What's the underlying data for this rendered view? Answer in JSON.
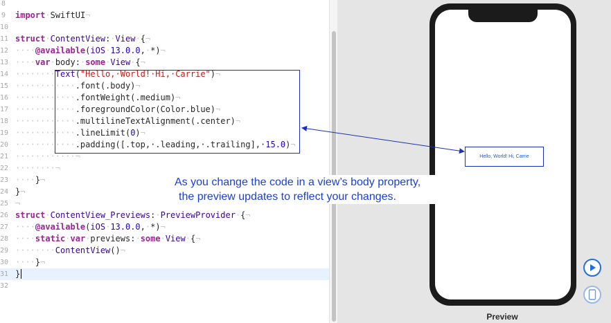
{
  "editor": {
    "lines": [
      {
        "n": "8",
        "tokens": []
      },
      {
        "n": "9",
        "tokens": [
          {
            "t": "import",
            "c": "kw"
          },
          {
            "t": "·",
            "c": "ws"
          },
          {
            "t": "SwiftUI",
            "c": "pl"
          },
          {
            "t": "¬",
            "c": "ws"
          }
        ]
      },
      {
        "n": "10",
        "tokens": []
      },
      {
        "n": "11",
        "tokens": [
          {
            "t": "struct",
            "c": "kw"
          },
          {
            "t": "·",
            "c": "ws"
          },
          {
            "t": "ContentView",
            "c": "tp"
          },
          {
            "t": ":",
            "c": "pl"
          },
          {
            "t": "·",
            "c": "ws"
          },
          {
            "t": "View",
            "c": "tp"
          },
          {
            "t": "·",
            "c": "ws"
          },
          {
            "t": "{",
            "c": "pl"
          },
          {
            "t": "¬",
            "c": "ws"
          }
        ]
      },
      {
        "n": "12",
        "tokens": [
          {
            "t": "····",
            "c": "ws"
          },
          {
            "t": "@available",
            "c": "kw"
          },
          {
            "t": "(",
            "c": "pl"
          },
          {
            "t": "iOS",
            "c": "tp"
          },
          {
            "t": "·",
            "c": "ws"
          },
          {
            "t": "13.0.0",
            "c": "nu"
          },
          {
            "t": ",",
            "c": "pl"
          },
          {
            "t": "·",
            "c": "ws"
          },
          {
            "t": "*)",
            "c": "pl"
          },
          {
            "t": "¬",
            "c": "ws"
          }
        ]
      },
      {
        "n": "13",
        "tokens": [
          {
            "t": "····",
            "c": "ws"
          },
          {
            "t": "var",
            "c": "kw"
          },
          {
            "t": "·",
            "c": "ws"
          },
          {
            "t": "body",
            "c": "pl"
          },
          {
            "t": ":",
            "c": "pl"
          },
          {
            "t": "·",
            "c": "ws"
          },
          {
            "t": "some",
            "c": "kw"
          },
          {
            "t": "·",
            "c": "ws"
          },
          {
            "t": "View",
            "c": "tp"
          },
          {
            "t": "·",
            "c": "ws"
          },
          {
            "t": "{",
            "c": "pl"
          },
          {
            "t": "¬",
            "c": "ws"
          }
        ]
      },
      {
        "n": "14",
        "tokens": [
          {
            "t": "········",
            "c": "ws"
          },
          {
            "t": "Text",
            "c": "tp"
          },
          {
            "t": "(",
            "c": "pl"
          },
          {
            "t": "\"Hello,·World!·Hi,·Carrie\"",
            "c": "st"
          },
          {
            "t": ")",
            "c": "pl"
          },
          {
            "t": "¬",
            "c": "ws"
          }
        ]
      },
      {
        "n": "15",
        "tokens": [
          {
            "t": "············",
            "c": "ws"
          },
          {
            "t": ".font(.body)",
            "c": "pl"
          },
          {
            "t": "¬",
            "c": "ws"
          }
        ]
      },
      {
        "n": "16",
        "tokens": [
          {
            "t": "············",
            "c": "ws"
          },
          {
            "t": ".fontWeight(.medium)",
            "c": "pl"
          },
          {
            "t": "¬",
            "c": "ws"
          }
        ]
      },
      {
        "n": "17",
        "tokens": [
          {
            "t": "············",
            "c": "ws"
          },
          {
            "t": ".foregroundColor(Color.blue)",
            "c": "pl"
          },
          {
            "t": "¬",
            "c": "ws"
          }
        ]
      },
      {
        "n": "18",
        "tokens": [
          {
            "t": "············",
            "c": "ws"
          },
          {
            "t": ".multilineTextAlignment(.center)",
            "c": "pl"
          },
          {
            "t": "¬",
            "c": "ws"
          }
        ]
      },
      {
        "n": "19",
        "tokens": [
          {
            "t": "············",
            "c": "ws"
          },
          {
            "t": ".lineLimit(",
            "c": "pl"
          },
          {
            "t": "0",
            "c": "nu"
          },
          {
            "t": ")",
            "c": "pl"
          },
          {
            "t": "¬",
            "c": "ws"
          }
        ]
      },
      {
        "n": "20",
        "tokens": [
          {
            "t": "············",
            "c": "ws"
          },
          {
            "t": ".padding([.top,·.leading,·.trailing],·",
            "c": "pl"
          },
          {
            "t": "15.0",
            "c": "nu"
          },
          {
            "t": ")",
            "c": "pl"
          },
          {
            "t": "¬",
            "c": "ws"
          }
        ]
      },
      {
        "n": "21",
        "tokens": [
          {
            "t": "············",
            "c": "ws"
          },
          {
            "t": "¬",
            "c": "ws"
          }
        ]
      },
      {
        "n": "22",
        "tokens": [
          {
            "t": "········",
            "c": "ws"
          },
          {
            "t": "¬",
            "c": "ws"
          }
        ]
      },
      {
        "n": "23",
        "tokens": [
          {
            "t": "····",
            "c": "ws"
          },
          {
            "t": "}",
            "c": "pl"
          },
          {
            "t": "¬",
            "c": "ws"
          }
        ]
      },
      {
        "n": "24",
        "tokens": [
          {
            "t": "}",
            "c": "pl"
          },
          {
            "t": "¬",
            "c": "ws"
          }
        ]
      },
      {
        "n": "25",
        "tokens": [
          {
            "t": "¬",
            "c": "ws"
          }
        ]
      },
      {
        "n": "26",
        "tokens": [
          {
            "t": "struct",
            "c": "kw"
          },
          {
            "t": "·",
            "c": "ws"
          },
          {
            "t": "ContentView_Previews",
            "c": "tp"
          },
          {
            "t": ":",
            "c": "pl"
          },
          {
            "t": "·",
            "c": "ws"
          },
          {
            "t": "PreviewProvider",
            "c": "tp"
          },
          {
            "t": "·",
            "c": "ws"
          },
          {
            "t": "{",
            "c": "pl"
          },
          {
            "t": "¬",
            "c": "ws"
          }
        ]
      },
      {
        "n": "27",
        "tokens": [
          {
            "t": "····",
            "c": "ws"
          },
          {
            "t": "@available",
            "c": "kw"
          },
          {
            "t": "(",
            "c": "pl"
          },
          {
            "t": "iOS",
            "c": "tp"
          },
          {
            "t": "·",
            "c": "ws"
          },
          {
            "t": "13.0.0",
            "c": "nu"
          },
          {
            "t": ",",
            "c": "pl"
          },
          {
            "t": "·",
            "c": "ws"
          },
          {
            "t": "*)",
            "c": "pl"
          },
          {
            "t": "¬",
            "c": "ws"
          }
        ]
      },
      {
        "n": "28",
        "tokens": [
          {
            "t": "····",
            "c": "ws"
          },
          {
            "t": "static",
            "c": "kw"
          },
          {
            "t": "·",
            "c": "ws"
          },
          {
            "t": "var",
            "c": "kw"
          },
          {
            "t": "·",
            "c": "ws"
          },
          {
            "t": "previews",
            "c": "pl"
          },
          {
            "t": ":",
            "c": "pl"
          },
          {
            "t": "·",
            "c": "ws"
          },
          {
            "t": "some",
            "c": "kw"
          },
          {
            "t": "·",
            "c": "ws"
          },
          {
            "t": "View",
            "c": "tp"
          },
          {
            "t": "·",
            "c": "ws"
          },
          {
            "t": "{",
            "c": "pl"
          },
          {
            "t": "¬",
            "c": "ws"
          }
        ]
      },
      {
        "n": "29",
        "tokens": [
          {
            "t": "········",
            "c": "ws"
          },
          {
            "t": "ContentView",
            "c": "tp"
          },
          {
            "t": "()",
            "c": "pl"
          },
          {
            "t": "¬",
            "c": "ws"
          }
        ]
      },
      {
        "n": "30",
        "tokens": [
          {
            "t": "····",
            "c": "ws"
          },
          {
            "t": "}",
            "c": "pl"
          },
          {
            "t": "¬",
            "c": "ws"
          }
        ]
      },
      {
        "n": "31",
        "tokens": [
          {
            "t": "}",
            "c": "pl"
          }
        ],
        "current": true
      },
      {
        "n": "32",
        "tokens": []
      }
    ]
  },
  "preview": {
    "label": "Preview",
    "text": "Hello, World! Hi, Carrie",
    "live_button_icon": "play-circle-icon",
    "device_button_icon": "device-icon"
  },
  "annotation": {
    "line1": "As you change the code in a view’s body property,",
    "line2": "the preview updates to reflect your changes."
  },
  "colors": {
    "keyword": "#9b2393",
    "type": "#3900a0",
    "string": "#c41a16",
    "number": "#1c00cf",
    "annotation": "#1a3fd6",
    "accent": "#1f6fe0"
  }
}
